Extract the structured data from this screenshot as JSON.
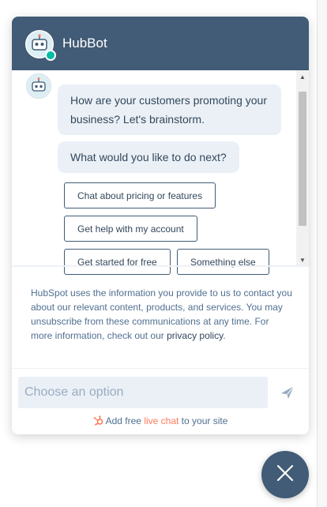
{
  "header": {
    "title": "HubBot",
    "avatar_icon": "robot-avatar-icon",
    "status": "online",
    "background_color": "#425b76"
  },
  "conversation": {
    "messages": [
      {
        "text": "How are your customers promoting your business? Let's brainstorm."
      },
      {
        "text": "What would you like to do next?"
      }
    ],
    "quick_replies": [
      "Chat about pricing or features",
      "Get help with my account",
      "Get started for free",
      "Something else"
    ]
  },
  "disclaimer": {
    "text": "HubSpot uses the information you provide to us to contact you about our relevant content, products, and services. You may unsubscribe from these communications at any time. For more information, check out our ",
    "link": "privacy policy",
    "end": "."
  },
  "composer": {
    "placeholder": "Choose an option",
    "send_icon": "send-icon"
  },
  "footer": {
    "prefix": "Add free ",
    "link": "live chat",
    "suffix": " to your site",
    "icon": "hubspot-sprocket-icon",
    "accent_color": "#ff7a59"
  },
  "launcher": {
    "icon": "close-icon"
  },
  "colors": {
    "bubble": "#eaf0f6",
    "text": "#33475b",
    "muted": "#516f90"
  }
}
